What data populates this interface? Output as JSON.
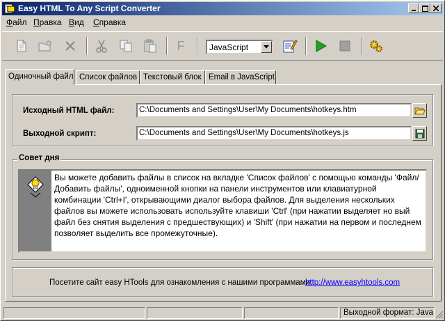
{
  "window": {
    "title": "Easy HTML To Any Script Converter"
  },
  "menu": [
    {
      "label": "Файл",
      "accel": "Ф",
      "rest": "айл"
    },
    {
      "label": "Правка",
      "accel": "П",
      "rest": "равка"
    },
    {
      "label": "Вид",
      "accel": "В",
      "rest": "ид"
    },
    {
      "label": "Справка",
      "accel": "С",
      "rest": "правка"
    }
  ],
  "toolbar": {
    "icons": [
      "new-file-icon",
      "add-files-icon",
      "delete-icon",
      "cut-icon",
      "copy-icon",
      "paste-icon",
      "font-icon",
      "edit-icon",
      "run-icon",
      "stop-icon",
      "settings-icon"
    ],
    "font_label": "F",
    "format_value": "JavaScript"
  },
  "tabs": [
    "Одиночный файл",
    "Список файлов",
    "Текстовый блок",
    "Email в JavaScript"
  ],
  "single_file": {
    "source_label": "Исходный HTML файл:",
    "source_value": "C:\\Documents and Settings\\User\\My Documents\\hotkeys.htm",
    "output_label": "Выходной скрипт:",
    "output_value": "C:\\Documents and Settings\\User\\My Documents\\hotkeys.js"
  },
  "tip": {
    "legend": "Совет дня",
    "text": "Вы можете добавить файлы в список на вкладке 'Список файлов' с помощью команды 'Файл/Добавить файлы', одноименной кнопки на панели инструментов или клавиатурной комбинации 'Ctrl+I', открывающими диалог выбора файлов. Для выделения нескольких файлов вы можете использовать используйте клавиши 'Ctrl' (при нажатии выделяет но вый файл без снятия выделения с предшествующих) и 'Shift' (при нажатии на первом и последнем позволяет выделить все промежуточные)."
  },
  "footer": {
    "visit_text": "Посетите сайт easy HTools для ознакомления с нашими программами:",
    "link_text": "http://www.easyhtools.com"
  },
  "status": {
    "format_text": "Выходной формат: JavaScript"
  },
  "colors": {
    "title_start": "#0a246a",
    "title_end": "#a6caf0",
    "face": "#d4d0c8",
    "link": "#0000ff",
    "run_green": "#1fa31f"
  }
}
